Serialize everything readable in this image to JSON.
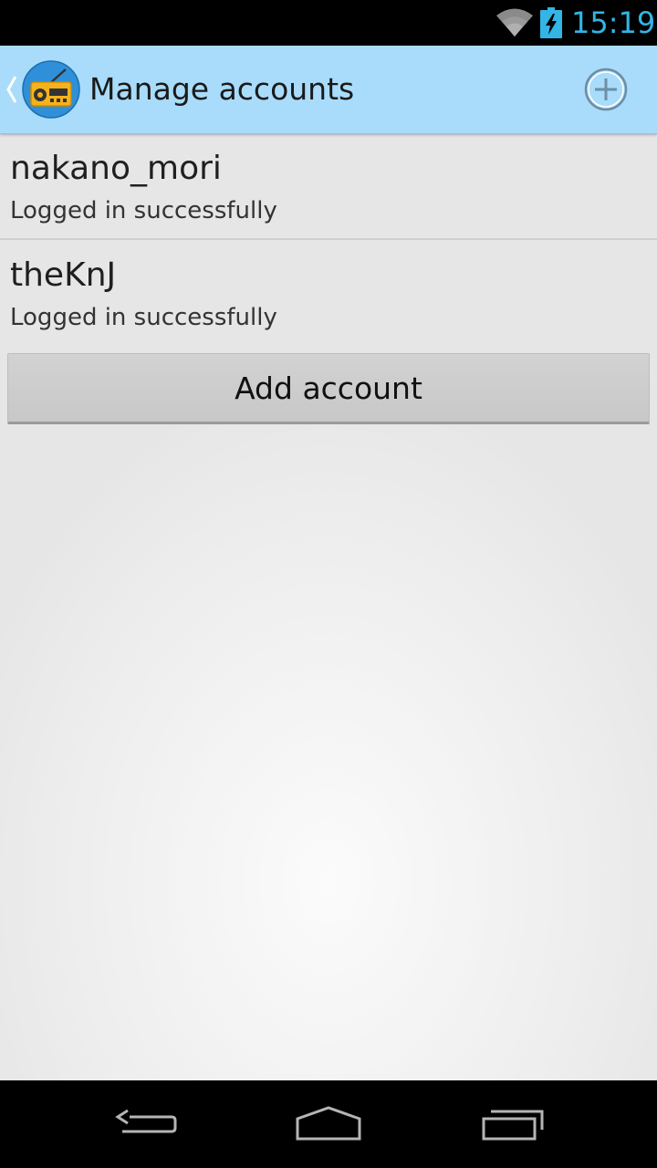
{
  "status_bar": {
    "time": "15:19",
    "icons": [
      "wifi-icon",
      "battery-charging-icon"
    ],
    "accent_color": "#33b5e5"
  },
  "action_bar": {
    "title": "Manage accounts",
    "app_icon": "radio-app-icon",
    "action_icon": "add-circle-icon",
    "background_color": "#a9dcfb"
  },
  "accounts": [
    {
      "name": "nakano_mori",
      "status": "Logged in successfully"
    },
    {
      "name": "theKnJ",
      "status": "Logged in successfully"
    }
  ],
  "add_account_button": {
    "label": "Add account"
  },
  "nav_bar": {
    "buttons": [
      "back-icon",
      "home-icon",
      "recents-icon"
    ]
  }
}
